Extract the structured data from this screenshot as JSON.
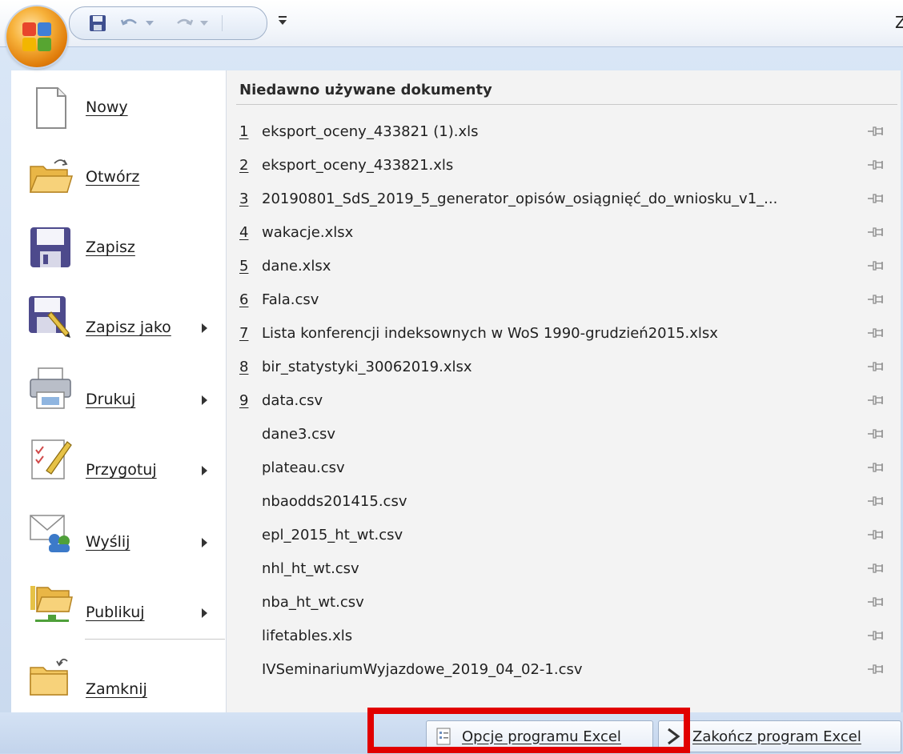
{
  "title_bar": {
    "title_fragment": "Z"
  },
  "colors": {
    "highlight_box": "#e10000",
    "menu_bg": "#d9e6f6",
    "office_button": "#f7b23b"
  },
  "office_menu": {
    "items": [
      {
        "label": "Nowy",
        "icon": "new-document-icon",
        "has_submenu": false
      },
      {
        "label": "Otwórz",
        "icon": "open-folder-icon",
        "has_submenu": false
      },
      {
        "label": "Zapisz",
        "icon": "save-icon",
        "has_submenu": false
      },
      {
        "label": "Zapisz jako",
        "icon": "save-as-icon",
        "has_submenu": true
      },
      {
        "label": "Drukuj",
        "icon": "printer-icon",
        "has_submenu": true
      },
      {
        "label": "Przygotuj",
        "icon": "prepare-icon",
        "has_submenu": true
      },
      {
        "label": "Wyślij",
        "icon": "send-icon",
        "has_submenu": true
      },
      {
        "label": "Publikuj",
        "icon": "publish-icon",
        "has_submenu": true
      },
      {
        "label": "Zamknij",
        "icon": "close-folder-icon",
        "has_submenu": false
      }
    ]
  },
  "recent": {
    "title": "Niedawno używane dokumenty",
    "items": [
      {
        "num": "1",
        "name": "eksport_oceny_433821 (1).xls"
      },
      {
        "num": "2",
        "name": "eksport_oceny_433821.xls"
      },
      {
        "num": "3",
        "name": "20190801_SdS_2019_5_generator_opisów_osiągnięć_do_wniosku_v1_..."
      },
      {
        "num": "4",
        "name": "wakacje.xlsx"
      },
      {
        "num": "5",
        "name": "dane.xlsx"
      },
      {
        "num": "6",
        "name": "Fala.csv"
      },
      {
        "num": "7",
        "name": "Lista konferencji indeksownych w WoS 1990-grudzień2015.xlsx"
      },
      {
        "num": "8",
        "name": "bir_statystyki_30062019.xlsx"
      },
      {
        "num": "9",
        "name": "data.csv"
      },
      {
        "num": "",
        "name": "dane3.csv"
      },
      {
        "num": "",
        "name": "plateau.csv"
      },
      {
        "num": "",
        "name": "nbaodds201415.csv"
      },
      {
        "num": "",
        "name": "epl_2015_ht_wt.csv"
      },
      {
        "num": "",
        "name": "nhl_ht_wt.csv"
      },
      {
        "num": "",
        "name": "nba_ht_wt.csv"
      },
      {
        "num": "",
        "name": "lifetables.xls"
      },
      {
        "num": "",
        "name": "IVSeminariumWyjazdowe_2019_04_02-1.csv"
      }
    ]
  },
  "bottom": {
    "options_label": "Opcje programu Excel",
    "exit_label": "Zakończ program Excel"
  }
}
